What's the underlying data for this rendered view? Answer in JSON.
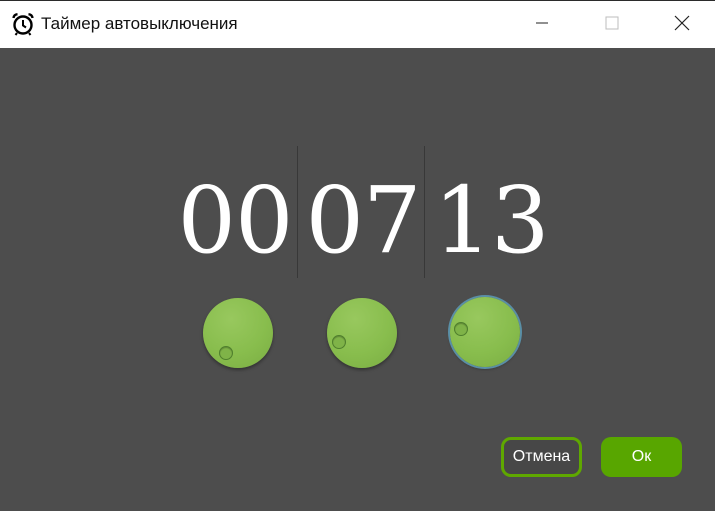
{
  "window": {
    "title": "Таймер автовыключения",
    "icon": "alarm-clock-icon"
  },
  "controls": {
    "minimize_icon": "minimize-icon",
    "maximize_icon": "maximize-icon",
    "close_icon": "close-icon"
  },
  "timer": {
    "hours": "00",
    "minutes": "07",
    "seconds": "13"
  },
  "buttons": {
    "cancel_label": "Отмена",
    "ok_label": "Ок"
  },
  "colors": {
    "accent": "#58a600",
    "dial": "#88bd4d",
    "background": "#4d4d4d",
    "active_ring": "#5a8fa6"
  }
}
